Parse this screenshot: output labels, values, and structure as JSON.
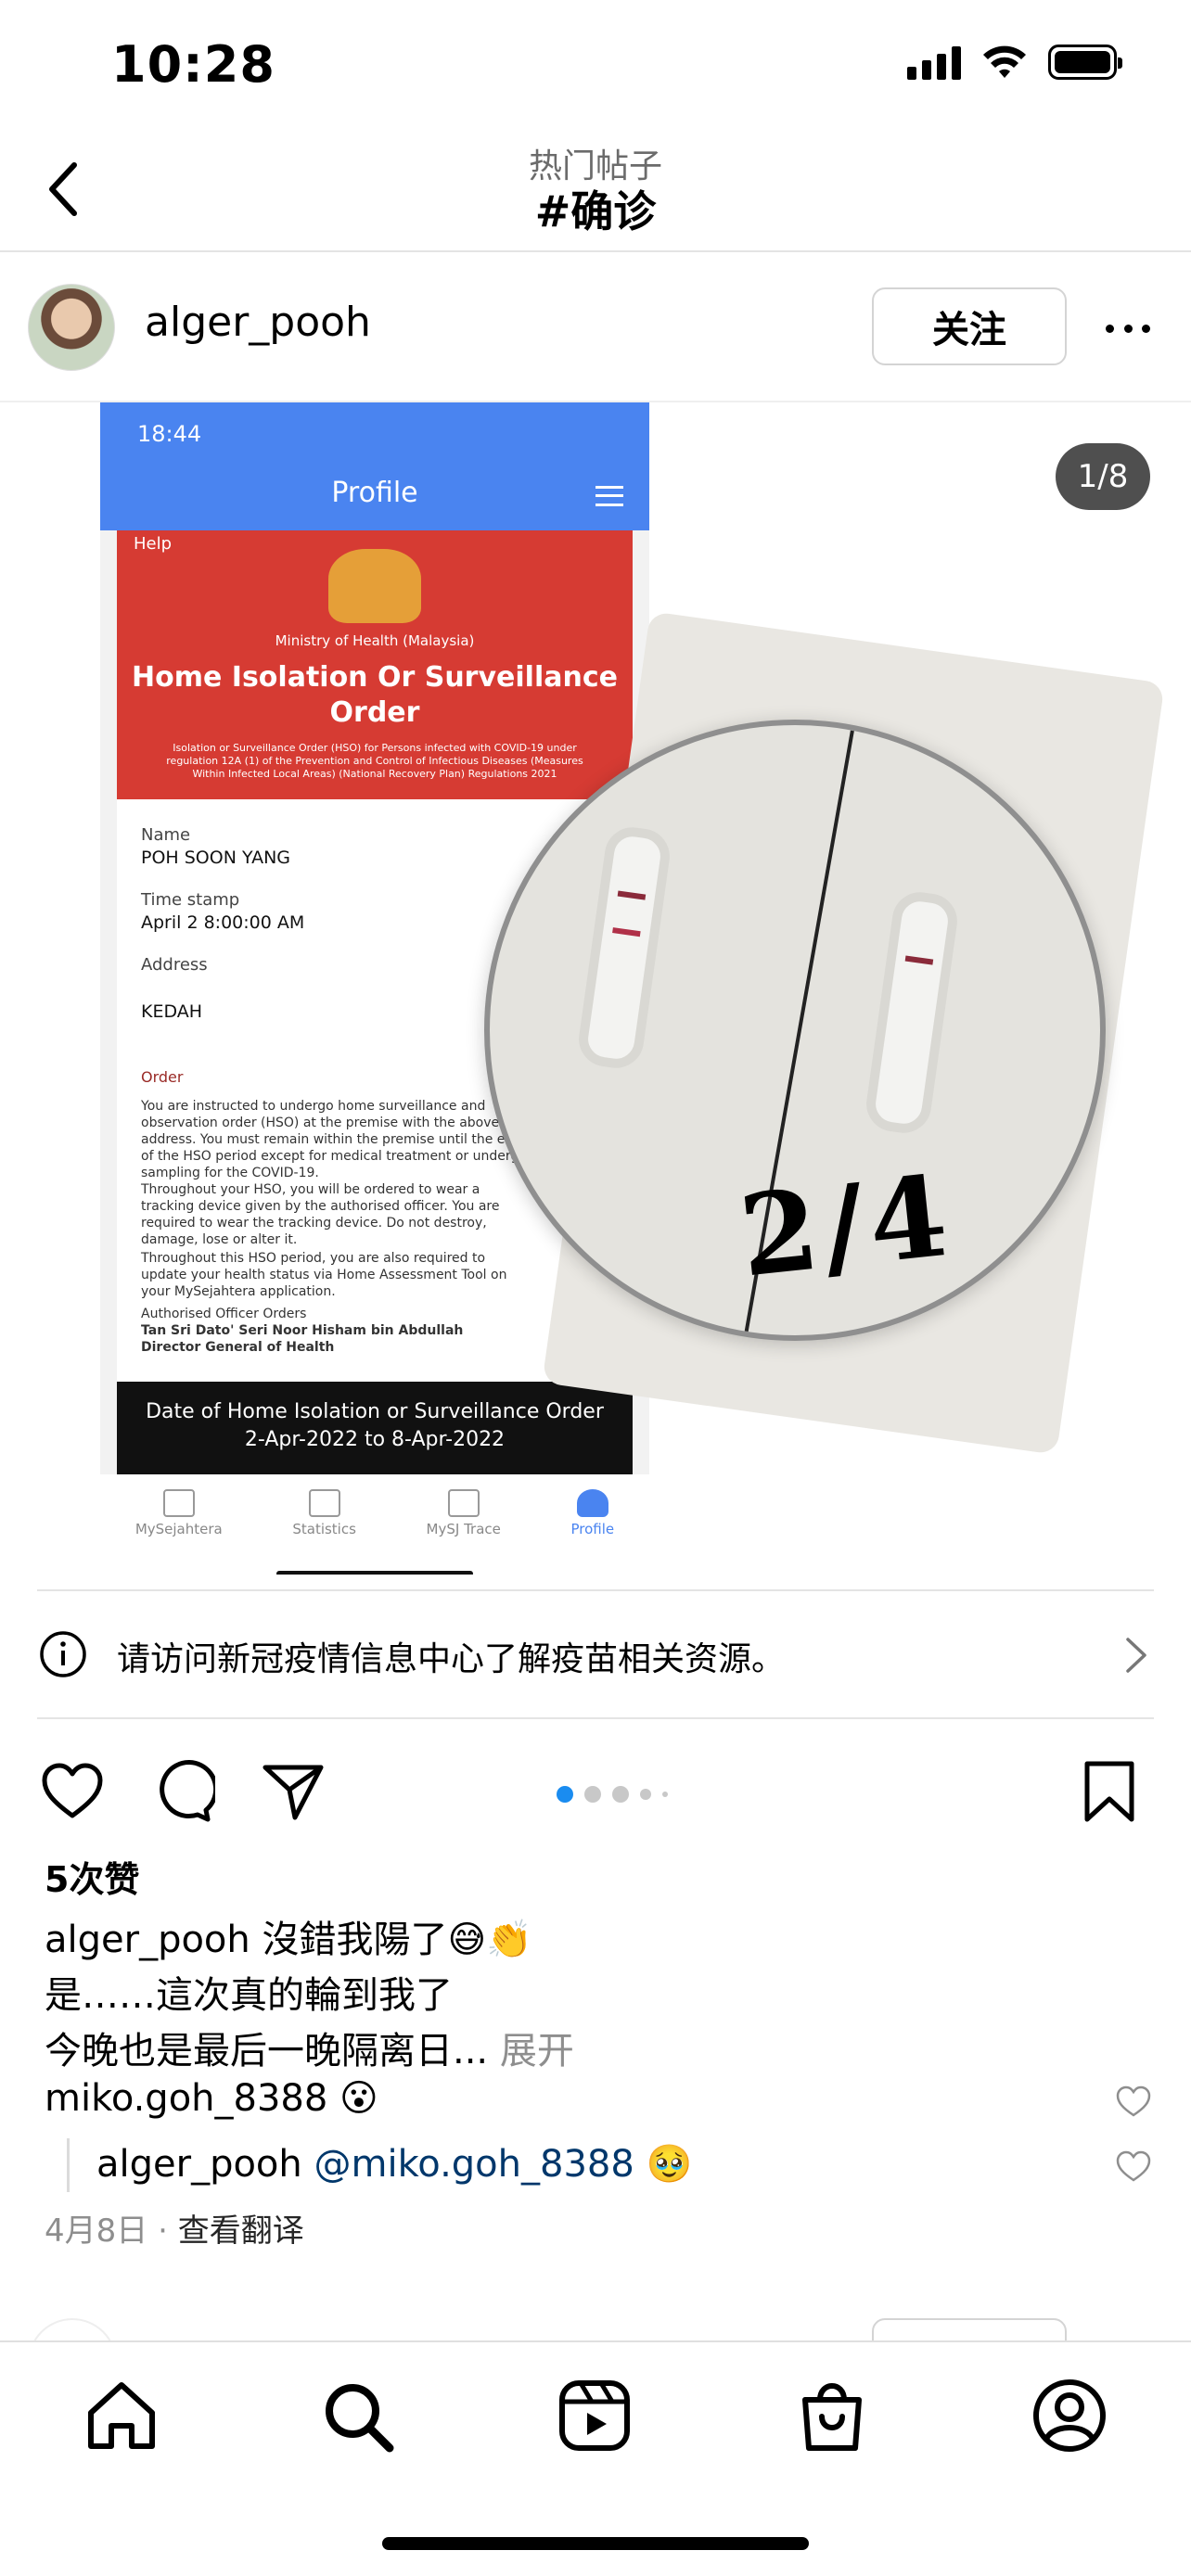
{
  "status_bar": {
    "time": "10:28"
  },
  "nav": {
    "subtitle": "热门帖子",
    "title": "#确诊",
    "back_icon": "chevron-left-icon"
  },
  "post": {
    "username": "alger_pooh",
    "follow_label": "关注",
    "slide_counter": "1/8",
    "slide_index": 1,
    "slide_total": 8
  },
  "media": {
    "screen_time": "18:44",
    "screen_title": "Profile",
    "help": "Help",
    "ministry": "Ministry of Health (Malaysia)",
    "heading": "Home Isolation Or Surveillance Order",
    "subheading": "Isolation or Surveillance Order (HSO) for Persons infected with COVID-19 under regulation 12A (1) of the Prevention and Control of Infectious Diseases (Measures Within Infected Local Areas) (National Recovery Plan) Regulations 2021",
    "name_label": "Name",
    "name_value": "POH SOON YANG",
    "timestamp_label": "Time stamp",
    "timestamp_value": "April 2 8:00:00 AM",
    "address_label": "Address",
    "address_value": "KEDAH",
    "order_label": "Order",
    "order_text_1": "You are instructed to undergo home surveillance and observation order (HSO) at the premise with the above address. You must remain within the premise until the end of the HSO period except for medical treatment or undergo sampling for the COVID-19.",
    "order_text_2": "Throughout your HSO, you will be ordered to wear a tracking device given by the authorised officer. You are required to wear the tracking device. Do not destroy, damage, lose or alter it.",
    "order_text_3": "Throughout this HSO period, you are also required to update your health status via Home Assessment Tool on your MySejahtera application.",
    "officer_label": "Authorised Officer Orders",
    "officer_name": "Tan Sri Dato' Seri Noor Hisham bin Abdullah",
    "officer_title": "Director General of Health",
    "order_date_label": "Date of Home Isolation or Surveillance Order",
    "order_date_value": "2-Apr-2022 to 8-Apr-2022",
    "tabs": [
      "MySejahtera",
      "Statistics",
      "MySJ Trace",
      "Profile"
    ],
    "handwritten_date": "2/4"
  },
  "info_banner": {
    "text": "请访问新冠疫情信息中心了解疫苗相关资源。",
    "icon": "info-icon"
  },
  "actions": {
    "like_icon": "heart-icon",
    "comment_icon": "comment-icon",
    "share_icon": "send-icon",
    "save_icon": "bookmark-icon"
  },
  "likes": "5次赞",
  "caption": {
    "user": "alger_pooh",
    "line1": " 沒錯我陽了😅👏",
    "line2": "是……這次真的輪到我了",
    "line3": "今晚也是最后一晚隔离日... ",
    "more": "展开"
  },
  "comments": [
    {
      "user": "miko.goh_8388",
      "text": " 😮"
    },
    {
      "user": "alger_pooh",
      "mention": "@miko.goh_8388",
      "text": " 🥹"
    }
  ],
  "meta": {
    "date": "4月8日",
    "separator": " · ",
    "translate": "查看翻译"
  },
  "tab_bar": [
    "home-icon",
    "search-icon",
    "reels-icon",
    "shop-icon",
    "profile-icon"
  ],
  "colors": {
    "accent": "#1a8cf0",
    "mention": "#00376b",
    "muted": "#8e8e8e",
    "screen_blue": "#4a84f0",
    "screen_red": "#d63b33"
  }
}
